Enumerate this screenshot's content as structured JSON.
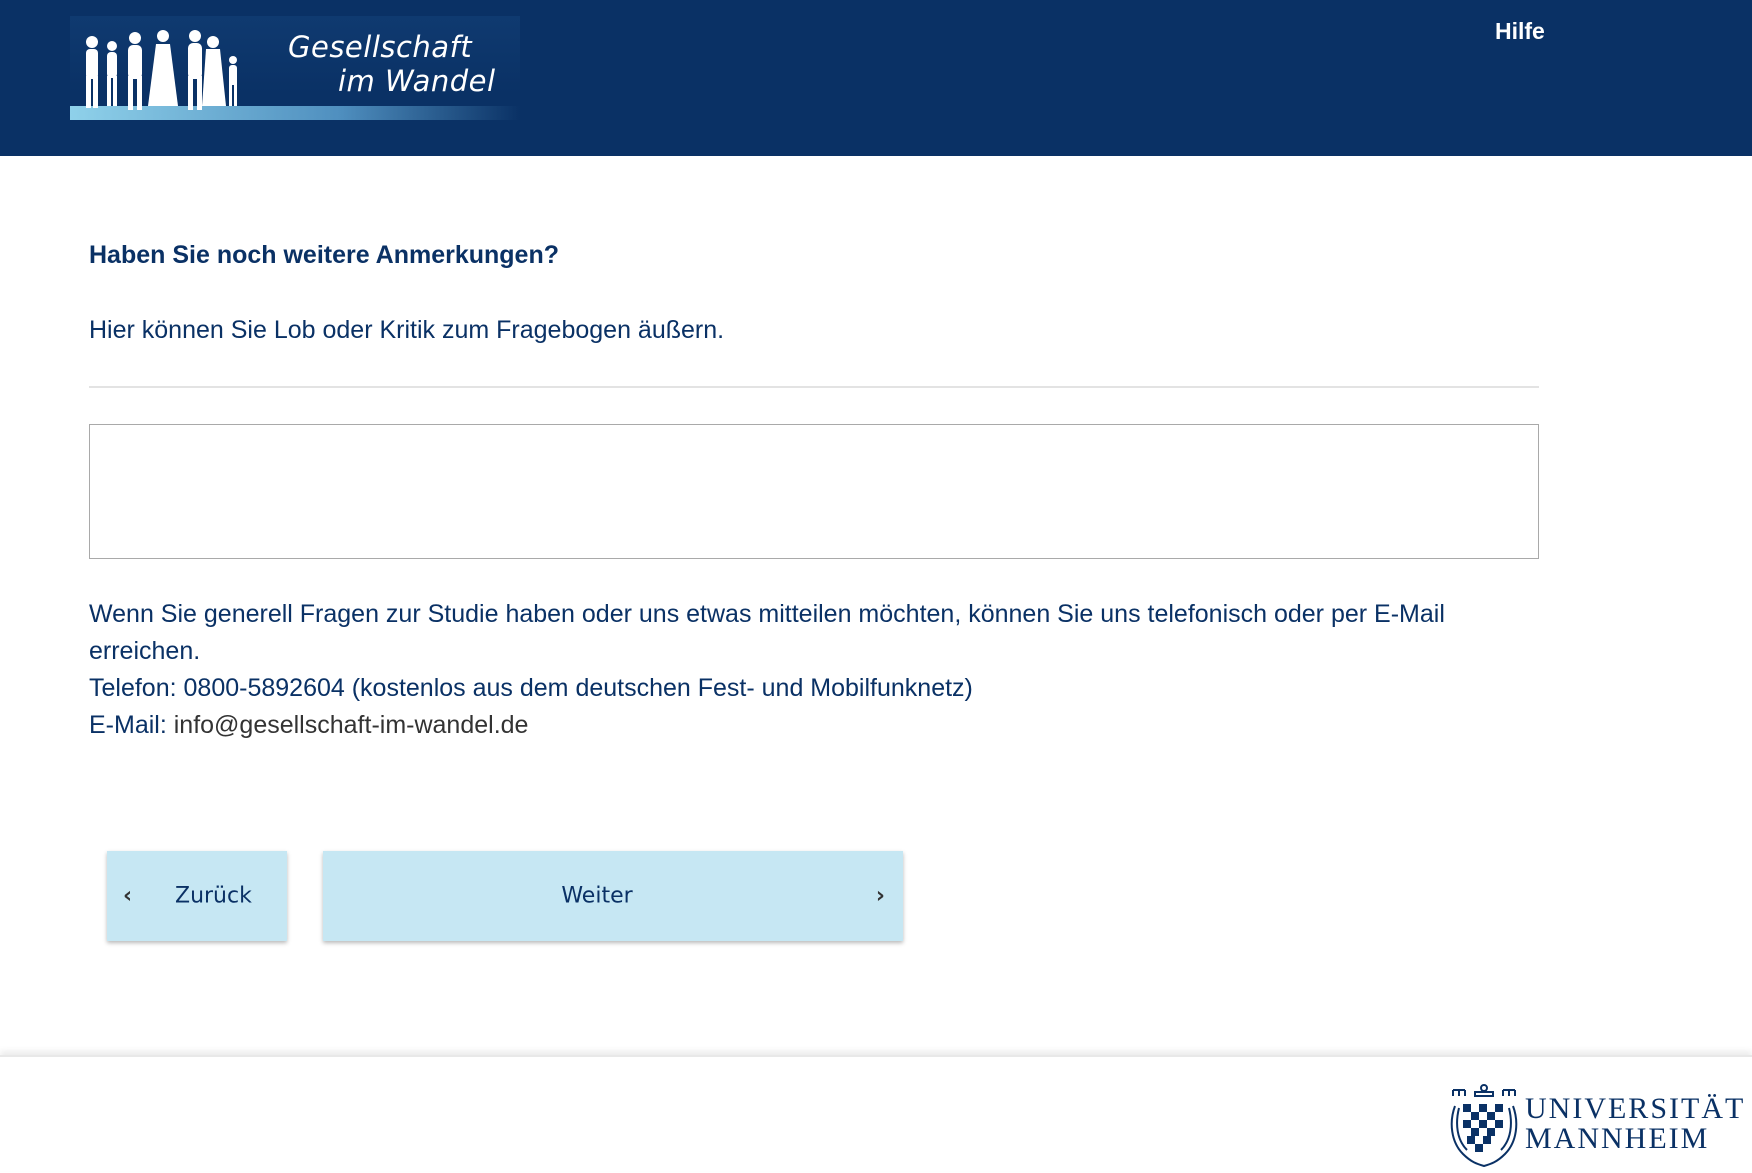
{
  "header": {
    "logo_line1": "Gesellschaft",
    "logo_line2": "im Wandel",
    "help_label": "Hilfe",
    "background_color": "#0a3165"
  },
  "question": {
    "title": "Haben Sie noch weitere Anmerkungen?",
    "hint": "Hier können Sie Lob oder Kritik zum Fragebogen äußern.",
    "comment_value": ""
  },
  "contact": {
    "intro": "Wenn Sie generell Fragen zur Studie haben oder uns etwas mitteilen möchten, können Sie uns telefonisch oder per E-Mail erreichen.",
    "phone": "Telefon: 0800-5892604 (kostenlos aus dem deutschen Fest- und Mobilfunknetz)",
    "email_label": "E-Mail: ",
    "email_value": "info@gesellschaft-im-wandel.de"
  },
  "navigation": {
    "back_label": "Zurück",
    "back_icon": "chevron-left-icon",
    "next_label": "Weiter",
    "next_icon": "chevron-right-icon",
    "button_color": "#c6e7f3"
  },
  "footer": {
    "university_line1": "UNIVERSITÄT",
    "university_line2": "MANNHEIM"
  }
}
